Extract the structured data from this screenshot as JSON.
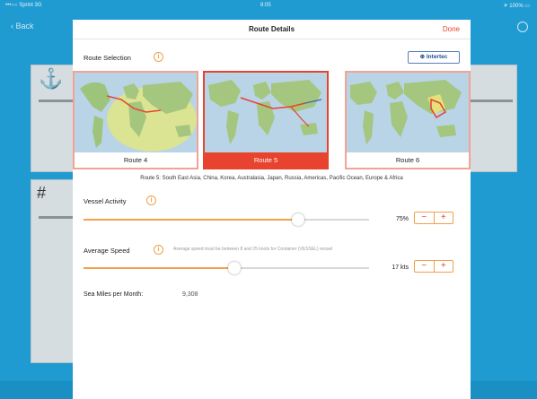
{
  "status_bar": {
    "left": "•••○○ Sprint 3G",
    "time": "8:05",
    "right": "✈ 100% ▭"
  },
  "background_app": {
    "back_label": "‹ Back",
    "help_icon": "help-icon"
  },
  "modal": {
    "title": "Route Details",
    "done_label": "Done",
    "route_selection_label": "Route Selection",
    "intertec_label": "⊕ Intertec",
    "routes": [
      {
        "label": "Route 4",
        "selected": false
      },
      {
        "label": "Route 5",
        "selected": true
      },
      {
        "label": "Route 6",
        "selected": false
      }
    ],
    "route_description": "Route 5: South East Asia, China, Korea, Australasia, Japan, Russia, Americas, Pacific Ocean, Europe & Africa",
    "vessel_activity": {
      "label": "Vessel Activity",
      "value": 75,
      "display": "75%"
    },
    "average_speed": {
      "label": "Average Speed",
      "note": "Average speed must be between 8 and 25 knots for Container (VESSEL) vessel",
      "value_knots": 17,
      "min": 8,
      "max": 25,
      "display": "17 kts"
    },
    "sea_miles": {
      "label": "Sea Miles per Month:",
      "value": "9,308"
    },
    "stepper": {
      "minus": "−",
      "plus": "+"
    }
  },
  "colors": {
    "accent": "#e8432e",
    "orange": "#f2a04c",
    "background": "#1f9bd2"
  }
}
